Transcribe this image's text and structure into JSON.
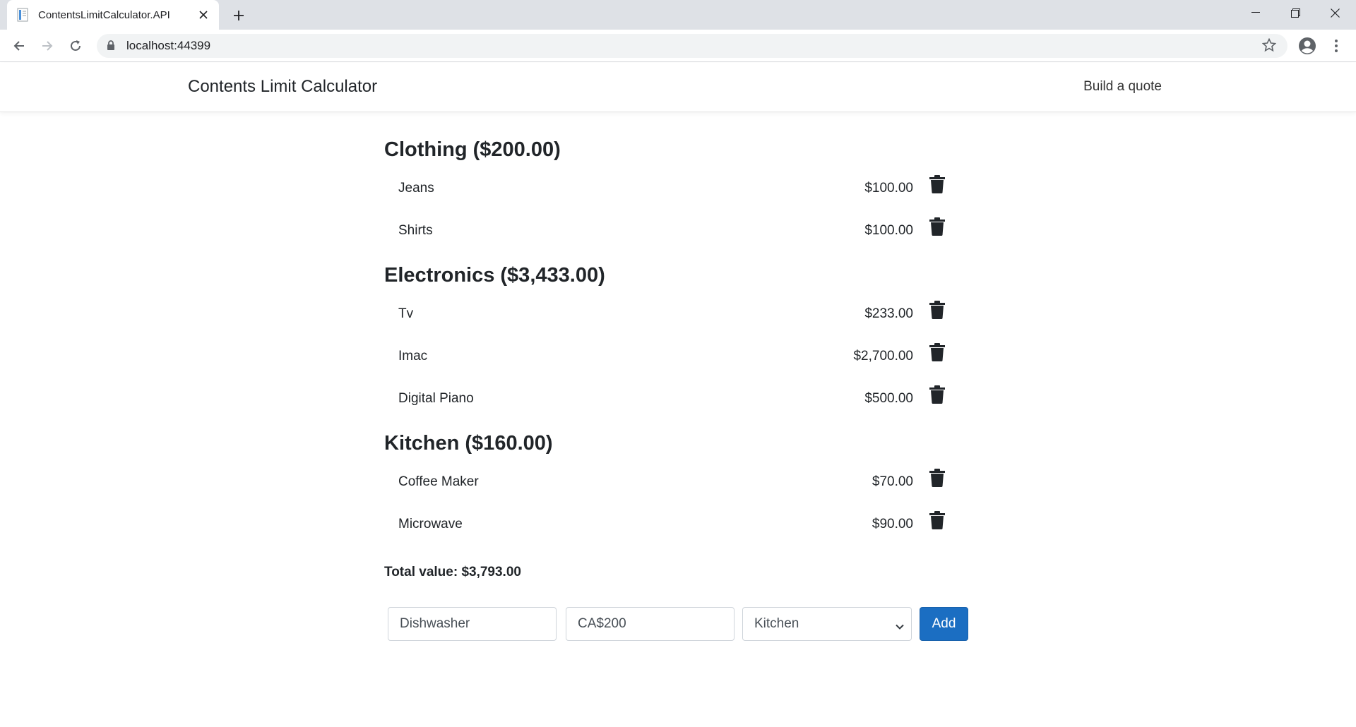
{
  "browser": {
    "tab_title": "ContentsLimitCalculator.API",
    "url": "localhost:44399"
  },
  "navbar": {
    "brand": "Contents Limit Calculator",
    "link": "Build a quote"
  },
  "categories": [
    {
      "heading": "Clothing ($200.00)",
      "items": [
        {
          "name": "Jeans",
          "price": "$100.00"
        },
        {
          "name": "Shirts",
          "price": "$100.00"
        }
      ]
    },
    {
      "heading": "Electronics ($3,433.00)",
      "items": [
        {
          "name": "Tv",
          "price": "$233.00"
        },
        {
          "name": "Imac",
          "price": "$2,700.00"
        },
        {
          "name": "Digital Piano",
          "price": "$500.00"
        }
      ]
    },
    {
      "heading": "Kitchen ($160.00)",
      "items": [
        {
          "name": "Coffee Maker",
          "price": "$70.00"
        },
        {
          "name": "Microwave",
          "price": "$90.00"
        }
      ]
    }
  ],
  "total_label": "Total value: $3,793.00",
  "form": {
    "name_value": "Dishwasher",
    "value_value": "CA$200",
    "category_selected": "Kitchen",
    "add_label": "Add"
  },
  "icons": {
    "trash": "trash-icon"
  },
  "colors": {
    "primary_button": "#1b6ec2"
  }
}
